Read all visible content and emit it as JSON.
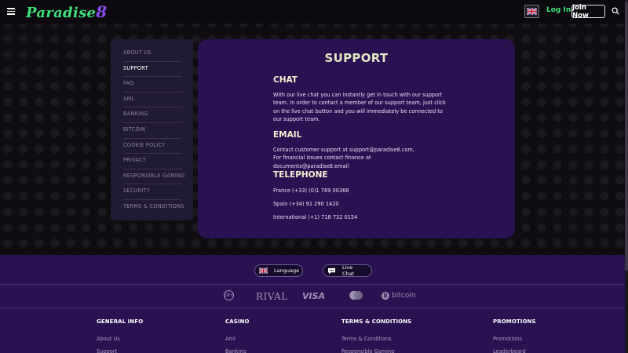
{
  "header": {
    "logo_text": "Paradise",
    "logo_number": "8",
    "login_label": "Log In",
    "join_label": "Join Now"
  },
  "sidebar": {
    "items": [
      {
        "label": "ABOUT US"
      },
      {
        "label": "SUPPORT"
      },
      {
        "label": "FAQ"
      },
      {
        "label": "AML"
      },
      {
        "label": "BANKING"
      },
      {
        "label": "BITCOIN"
      },
      {
        "label": "COOKIE POLICY"
      },
      {
        "label": "PRIVACY"
      },
      {
        "label": "RESPONSIBLE GAMING"
      },
      {
        "label": "SECURITY"
      },
      {
        "label": "TERMS & CONDITIONS"
      }
    ],
    "active_index": 1
  },
  "main": {
    "title": "SUPPORT",
    "chat": {
      "heading": "CHAT",
      "body": "With our live chat you can instantly get in touch with our support team. In order to contact a member of our support team, just click on the live chat button and you will immediately be connected to our support team."
    },
    "email": {
      "heading": "EMAIL",
      "line1": "Contact customer support at support@paradise8.com,",
      "line2": "For financial issues contact finance at documents@paradise8.email"
    },
    "telephone": {
      "heading": "TELEPHONE",
      "france": "France (+33) (0)1 789 00368",
      "spain": "Spain (+34) 91 290 1420",
      "international": "International (+1) 718 732 0154"
    }
  },
  "footer": {
    "language_label": "Language",
    "livechat_label": "Live Chat",
    "payments": {
      "age": "18+",
      "rival": "RIVAL",
      "visa": "VISA",
      "bitcoin": "bitcoin"
    },
    "columns": [
      {
        "heading": "GENERAL INFO",
        "links": [
          "About Us",
          "Support"
        ]
      },
      {
        "heading": "CASINO",
        "links": [
          "Aml",
          "Banking"
        ]
      },
      {
        "heading": "TERMS & CONDITIONS",
        "links": [
          "Terms & Conditions",
          "Responsible Gaming"
        ]
      },
      {
        "heading": "PROMOTIONS",
        "links": [
          "Promotions",
          "Leaderboard"
        ]
      }
    ]
  },
  "colors": {
    "accent_green": "#3ee07a",
    "accent_purple": "#8a4cf0",
    "card_bg": "#2a1152",
    "heading_cream": "#f3f0d0"
  }
}
